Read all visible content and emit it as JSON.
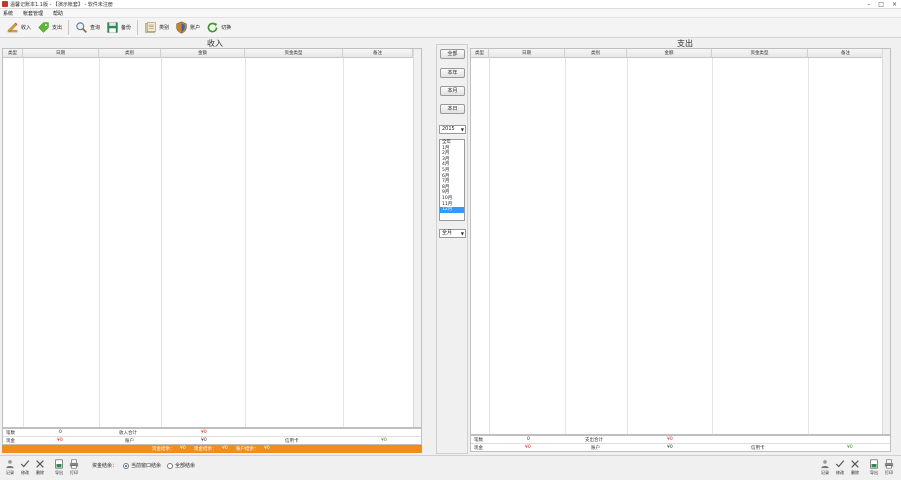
{
  "window": {
    "title": "温馨记账本1.1版 - 【演示帐套】 - 软件未注册",
    "controls": [
      "minimize-icon",
      "maximize-icon",
      "close-icon"
    ]
  },
  "menu": [
    "系统",
    "帐套管理",
    "帮助"
  ],
  "toolbar": [
    {
      "name": "income",
      "label": "收入",
      "icon": "pencil-icon"
    },
    {
      "name": "expense",
      "label": "支出",
      "icon": "tag-icon"
    },
    {
      "name": "query",
      "label": "查询",
      "icon": "magnifier-icon"
    },
    {
      "name": "backup",
      "label": "备份",
      "icon": "floppy-icon"
    },
    {
      "name": "category",
      "label": "类别",
      "icon": "ledger-icon"
    },
    {
      "name": "account",
      "label": "账户",
      "icon": "shield-icon"
    },
    {
      "name": "switch",
      "label": "切换",
      "icon": "refresh-icon"
    }
  ],
  "income": {
    "title": "收入",
    "columns": [
      "类型",
      "日期",
      "类别",
      "金额",
      "资金类型",
      "备注"
    ],
    "summary": {
      "count_label": "笔数",
      "count_value": "0",
      "total_label": "收入合计",
      "total_value": "¥0",
      "cash_label": "现金",
      "cash_value": "¥0",
      "account_label": "账户",
      "account_value": "¥0",
      "credit_label": "信用卡",
      "credit_value": "¥0"
    },
    "balance_bar": {
      "fund_label": "资金结余：",
      "fund_value": "¥0",
      "cash_label": "现金结余：",
      "cash_value": "¥0",
      "account_label": "账户结余：",
      "account_value": "¥0"
    }
  },
  "expense": {
    "title": "支出",
    "columns": [
      "类型",
      "日期",
      "类别",
      "金额",
      "资金类型",
      "备注"
    ],
    "summary": {
      "count_label": "笔数",
      "count_value": "0",
      "total_label": "支出合计",
      "total_value": "¥0",
      "cash_label": "现金",
      "cash_value": "¥0",
      "account_label": "账户",
      "account_value": "¥0",
      "credit_label": "信用卡",
      "credit_value": "¥0"
    }
  },
  "middle": {
    "buttons": [
      "全部",
      "本年",
      "本月",
      "本日"
    ],
    "year_select": "2015",
    "months": [
      "全年",
      "1月",
      "2月",
      "3月",
      "4月",
      "5月",
      "6月",
      "7月",
      "8月",
      "9月",
      "10月",
      "11月",
      "12月"
    ],
    "selected_month_index": 12,
    "day_select": "全月"
  },
  "bottom": {
    "left_buttons": [
      {
        "name": "add",
        "label": "记录"
      },
      {
        "name": "edit",
        "label": "修改"
      },
      {
        "name": "delete",
        "label": "删除"
      },
      {
        "name": "export",
        "label": "导出"
      },
      {
        "name": "print",
        "label": "打印"
      }
    ],
    "fund_label": "资金结余：",
    "radio_options": [
      {
        "label": "当前窗口结余",
        "checked": true
      },
      {
        "label": "全部结余",
        "checked": false
      }
    ],
    "right_buttons": [
      {
        "name": "add",
        "label": "记录"
      },
      {
        "name": "edit",
        "label": "修改"
      },
      {
        "name": "delete",
        "label": "删除"
      },
      {
        "name": "export",
        "label": "导出"
      },
      {
        "name": "print",
        "label": "打印"
      }
    ]
  },
  "colors": {
    "accent_orange": "#f28c1a",
    "negative_red": "#dd2222",
    "positive_green": "#4a8a1e",
    "selection_blue": "#3399ff"
  }
}
